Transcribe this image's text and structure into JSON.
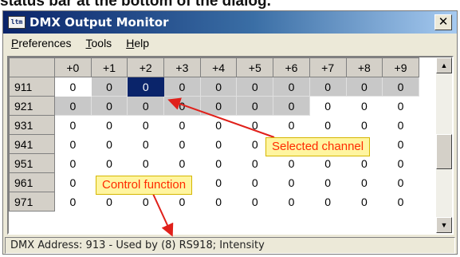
{
  "caption": "status bar at the bottom of the dialog.",
  "window": {
    "title": "DMX Output Monitor",
    "icon": "app-icon",
    "icon_text": "ltm",
    "close_glyph": "✕"
  },
  "menu": [
    "Preferences",
    "Tools",
    "Help"
  ],
  "grid": {
    "column_headers": [
      "+0",
      "+1",
      "+2",
      "+3",
      "+4",
      "+5",
      "+6",
      "+7",
      "+8",
      "+9"
    ],
    "rows": [
      {
        "address": "911",
        "values": [
          "0",
          "0",
          "0",
          "0",
          "0",
          "0",
          "0",
          "0",
          "0",
          "0"
        ],
        "active": [
          false,
          true,
          false,
          true,
          true,
          true,
          true,
          true,
          true,
          true
        ],
        "selected_index": 2
      },
      {
        "address": "921",
        "values": [
          "0",
          "0",
          "0",
          "0",
          "0",
          "0",
          "0",
          "0",
          "0",
          "0"
        ],
        "active": [
          true,
          true,
          true,
          true,
          true,
          true,
          true,
          false,
          false,
          false
        ],
        "selected_index": -1
      },
      {
        "address": "931",
        "values": [
          "0",
          "0",
          "0",
          "0",
          "0",
          "0",
          "0",
          "0",
          "0",
          "0"
        ],
        "active": [
          false,
          false,
          false,
          false,
          false,
          false,
          false,
          false,
          false,
          false
        ],
        "selected_index": -1
      },
      {
        "address": "941",
        "values": [
          "0",
          "0",
          "0",
          "0",
          "0",
          "0",
          "0",
          "0",
          "0",
          "0"
        ],
        "active": [
          false,
          false,
          false,
          false,
          false,
          false,
          false,
          false,
          false,
          false
        ],
        "selected_index": -1
      },
      {
        "address": "951",
        "values": [
          "0",
          "0",
          "0",
          "0",
          "0",
          "0",
          "0",
          "0",
          "0",
          "0"
        ],
        "active": [
          false,
          false,
          false,
          false,
          false,
          false,
          false,
          false,
          false,
          false
        ],
        "selected_index": -1
      },
      {
        "address": "961",
        "values": [
          "0",
          "0",
          "0",
          "0",
          "0",
          "0",
          "0",
          "0",
          "0",
          "0"
        ],
        "active": [
          false,
          false,
          false,
          false,
          false,
          false,
          false,
          false,
          false,
          false
        ],
        "selected_index": -1
      },
      {
        "address": "971",
        "values": [
          "0",
          "0",
          "0",
          "0",
          "0",
          "0",
          "0",
          "0",
          "0",
          "0"
        ],
        "active": [
          false,
          false,
          false,
          false,
          false,
          false,
          false,
          false,
          false,
          false
        ],
        "selected_index": -1
      }
    ]
  },
  "scrollbar": {
    "up_glyph": "▲",
    "down_glyph": "▼"
  },
  "status": "DMX Address: 913 - Used by (8) RS918; Intensity",
  "annotations": {
    "selected_channel": "Selected channel",
    "control_function": "Control function"
  },
  "colors": {
    "selected": "#0a246a",
    "active_cell": "#c8c8c8",
    "callout_bg": "#fff5a0",
    "callout_text": "#ff2a00",
    "arrow": "#e0201a"
  }
}
